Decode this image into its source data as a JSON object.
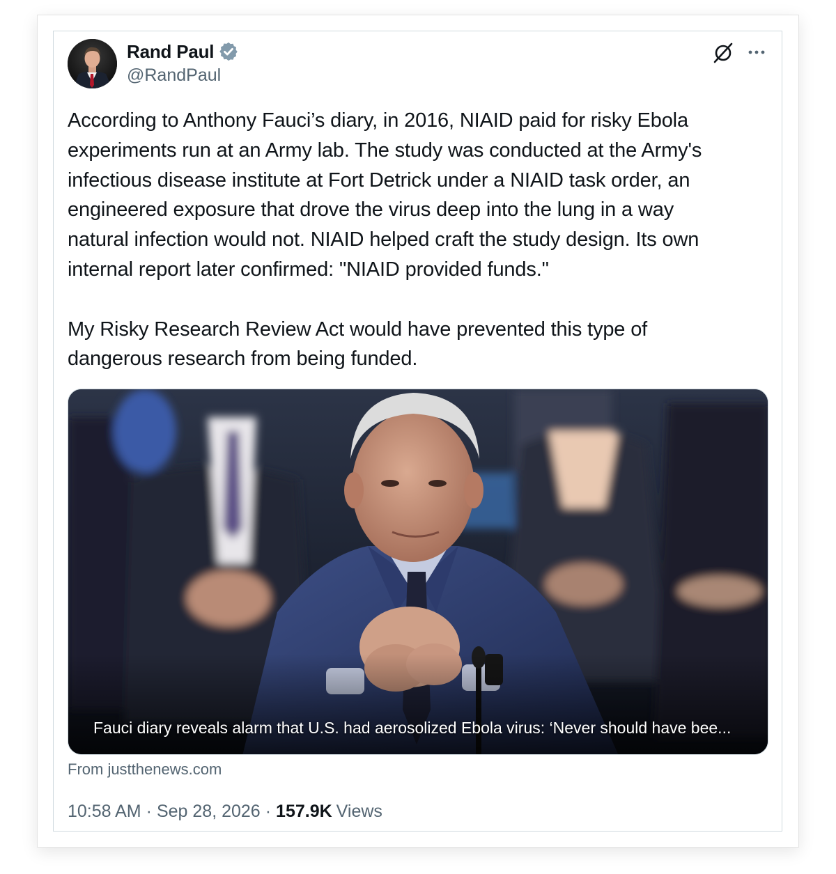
{
  "author": {
    "display_name": "Rand Paul",
    "handle": "@RandPaul",
    "verified": true
  },
  "header_icons": [
    "grok-icon",
    "more-icon"
  ],
  "tweet": {
    "paragraph_1": "According to Anthony Fauci’s diary, in 2016, NIAID paid for risky Ebola\nexperiments run at an Army lab. The study was conducted at the Army's\ninfectious disease institute at Fort Detrick under a NIAID task order, an\nengineered exposure that drove the virus deep into the lung in a way\nnatural infection would not. NIAID helped craft the study design. Its own\ninternal report later confirmed: \"NIAID provided funds.\"",
    "paragraph_2": "My Risky Research Review Act would have prevented this type of\ndangerous research from being funded."
  },
  "link_card": {
    "headline": "Fauci diary reveals alarm that U.S. had aerosolized Ebola virus: ‘Never should have bee...",
    "source": "From justthenews.com"
  },
  "meta": {
    "time": "10:58 AM",
    "date": "Sep 28, 2026",
    "separator": "·",
    "views_count": "157.9K",
    "views_label": "Views"
  },
  "colors": {
    "text_primary": "#0f1419",
    "text_secondary": "#536471",
    "border": "#cfd9de",
    "verified_badge": "#829aab"
  }
}
